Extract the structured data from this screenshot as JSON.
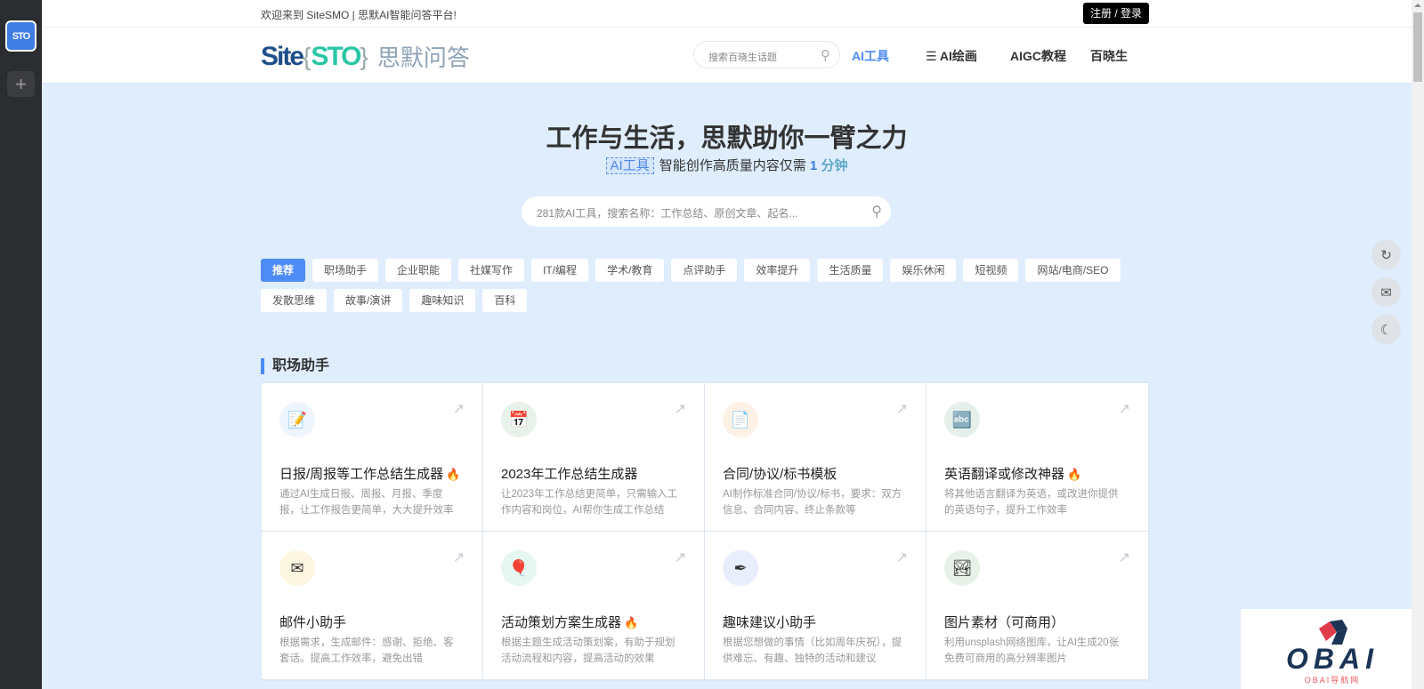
{
  "sidebar": {
    "app_label": "STO",
    "add_label": "+"
  },
  "topbar": {
    "welcome": "欢迎来到 SiteSMO | 思默AI智能问答平台!",
    "login": "注册 / 登录"
  },
  "header": {
    "logo": {
      "site": "Site",
      "brace_open": "{",
      "smo": "STO",
      "brace_close": "}",
      "cn": "思默问答"
    },
    "search_placeholder": "搜索百晓生话题",
    "nav": [
      {
        "label": "AI工具",
        "active": true
      },
      {
        "label": "☰ AI绘画"
      },
      {
        "label": "AIGC教程"
      },
      {
        "label": "百晓生"
      }
    ]
  },
  "hero": {
    "title": "工作与生活，思默助你一臂之力",
    "tag": "AI工具",
    "sub_text": "智能创作高质量内容仅需",
    "num": "1",
    "unit": "分钟",
    "search_placeholder": "281款AI工具，搜索名称：工作总结、原创文章、起名..."
  },
  "categories": [
    "推荐",
    "职场助手",
    "企业职能",
    "社媒写作",
    "IT/编程",
    "学术/教育",
    "点评助手",
    "效率提升",
    "生活质量",
    "娱乐休闲",
    "短视频",
    "网站/电商/SEO",
    "发散思维",
    "故事/演讲",
    "趣味知识",
    "百科"
  ],
  "section": {
    "title": "职场助手"
  },
  "cards": [
    {
      "name": "日报/周报等工作总结生成器",
      "hot": true,
      "desc": "通过AI生成日报、周报、月报、季度报，让工作报告更简单，大大提升效率",
      "icon": "document-edit-icon",
      "icon_glyph": "📝",
      "bg": "#eef5fc"
    },
    {
      "name": "2023年工作总结生成器",
      "hot": false,
      "desc": "让2023年工作总结更简单，只需输入工作内容和岗位，AI帮你生成工作总结",
      "icon": "calendar-icon",
      "icon_glyph": "📅",
      "bg": "#e8f2ea"
    },
    {
      "name": "合同/协议/标书模板",
      "hot": false,
      "desc": "AI制作标准合同/协议/标书，要求：双方信息、合同内容、终止条款等",
      "icon": "contract-stamp-icon",
      "icon_glyph": "📄",
      "bg": "#fdf1e6"
    },
    {
      "name": "英语翻译或修改神器",
      "hot": true,
      "desc": "将其他语言翻译为英语，或改进你提供的英语句子，提升工作效率",
      "icon": "abc-blocks-icon",
      "icon_glyph": "🔤",
      "bg": "#e6f0ea"
    },
    {
      "name": "邮件小助手",
      "hot": false,
      "desc": "根据需求，生成邮件：感谢、拒绝、客套话。提高工作效率，避免出错",
      "icon": "envelope-icon",
      "icon_glyph": "✉",
      "bg": "#fdf6e0"
    },
    {
      "name": "活动策划方案生成器",
      "hot": true,
      "desc": "根据主题生成活动策划案，有助于规划活动流程和内容，提高活动的效果",
      "icon": "balloons-icon",
      "icon_glyph": "🎈",
      "bg": "#e6f6f0"
    },
    {
      "name": "趣味建议小助手",
      "hot": false,
      "desc": "根据您想做的事情（比如周年庆祝），提供难忘、有趣、独特的活动和建议",
      "icon": "pen-icon",
      "icon_glyph": "✒",
      "bg": "#e8eefb"
    },
    {
      "name": "图片素材（可商用）",
      "hot": false,
      "desc": "利用unsplash网络图库，让AI生成20张免费可商用的高分辨率图片",
      "icon": "landscape-image-icon",
      "icon_glyph": "🏞",
      "bg": "#e8f1e8"
    }
  ],
  "hot_glyph": "🔥",
  "arrow_glyph": "↗",
  "float_buttons": [
    {
      "icon": "share-icon",
      "glyph": "↻"
    },
    {
      "icon": "inbox-icon",
      "glyph": "✉"
    },
    {
      "icon": "dark-mode-icon",
      "glyph": "☾"
    }
  ],
  "watermark": {
    "word": "OBAI",
    "sub": "OBAI导航网"
  },
  "colors": {
    "accent": "#4d8bf5",
    "hero_bg": "#dfedfd",
    "sidebar": "#2b2d30"
  }
}
